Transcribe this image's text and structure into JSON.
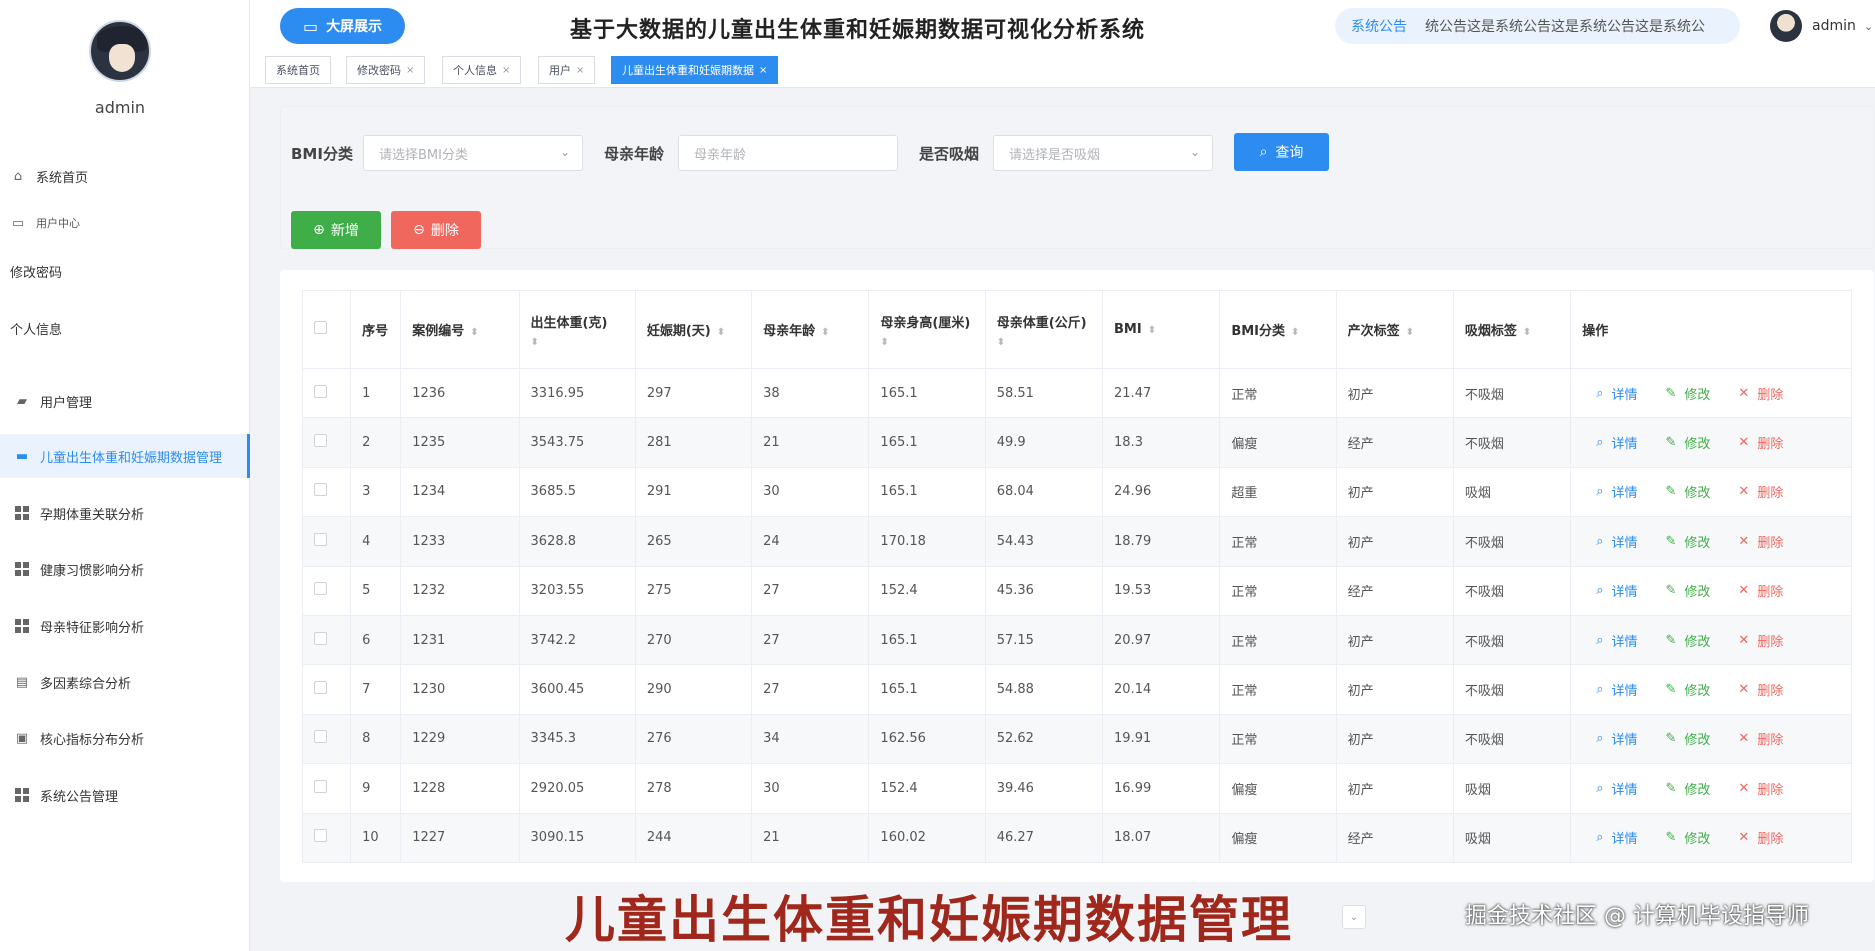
{
  "header": {
    "bigscreen_label": "大屏展示",
    "title": "基于大数据的儿童出生体重和妊娠期数据可视化分析系统",
    "notice_label": "系统公告",
    "notice_text": "统公告这是系统公告这是系统公告这是系统公",
    "username": "admin"
  },
  "sidebar": {
    "username": "admin",
    "items": [
      {
        "label": "系统首页",
        "icon": "home-icon"
      },
      {
        "label": "用户中心",
        "icon": "id-card-icon"
      },
      {
        "label": "修改密码",
        "icon": ""
      },
      {
        "label": "个人信息",
        "icon": ""
      },
      {
        "label": "用户管理",
        "icon": "user-manage-icon"
      },
      {
        "label": "儿童出生体重和妊娠期数据管理",
        "icon": "briefcase-icon"
      },
      {
        "label": "孕期体重关联分析",
        "icon": "grid-icon"
      },
      {
        "label": "健康习惯影响分析",
        "icon": "grid-icon"
      },
      {
        "label": "母亲特征影响分析",
        "icon": "grid-icon"
      },
      {
        "label": "多因素综合分析",
        "icon": "document-icon"
      },
      {
        "label": "核心指标分布分析",
        "icon": "printer-icon"
      },
      {
        "label": "系统公告管理",
        "icon": "grid-icon"
      }
    ]
  },
  "tabs": [
    {
      "label": "系统首页",
      "closable": false
    },
    {
      "label": "修改密码",
      "closable": true
    },
    {
      "label": "个人信息",
      "closable": true
    },
    {
      "label": "用户",
      "closable": true
    },
    {
      "label": "儿童出生体重和妊娠期数据",
      "closable": true,
      "active": true
    }
  ],
  "search": {
    "bmi_label": "BMI分类",
    "bmi_placeholder": "请选择BMI分类",
    "age_label": "母亲年龄",
    "age_placeholder": "母亲年龄",
    "smoke_label": "是否吸烟",
    "smoke_placeholder": "请选择是否吸烟",
    "query_label": "查询",
    "add_label": "新增",
    "delete_label": "删除"
  },
  "table": {
    "columns": [
      "序号",
      "案例编号",
      "出生体重(克)",
      "妊娠期(天)",
      "母亲年龄",
      "母亲身高(厘米)",
      "母亲体重(公斤)",
      "BMI",
      "BMI分类",
      "产次标签",
      "吸烟标签",
      "操作"
    ],
    "actions": {
      "detail": "详情",
      "edit": "修改",
      "delete": "删除"
    },
    "rows": [
      [
        "1",
        "1236",
        "3316.95",
        "297",
        "38",
        "165.1",
        "58.51",
        "21.47",
        "正常",
        "初产",
        "不吸烟"
      ],
      [
        "2",
        "1235",
        "3543.75",
        "281",
        "21",
        "165.1",
        "49.9",
        "18.3",
        "偏瘦",
        "经产",
        "不吸烟"
      ],
      [
        "3",
        "1234",
        "3685.5",
        "291",
        "30",
        "165.1",
        "68.04",
        "24.96",
        "超重",
        "初产",
        "吸烟"
      ],
      [
        "4",
        "1233",
        "3628.8",
        "265",
        "24",
        "170.18",
        "54.43",
        "18.79",
        "正常",
        "初产",
        "不吸烟"
      ],
      [
        "5",
        "1232",
        "3203.55",
        "275",
        "27",
        "152.4",
        "45.36",
        "19.53",
        "正常",
        "经产",
        "不吸烟"
      ],
      [
        "6",
        "1231",
        "3742.2",
        "270",
        "27",
        "165.1",
        "57.15",
        "20.97",
        "正常",
        "初产",
        "不吸烟"
      ],
      [
        "7",
        "1230",
        "3600.45",
        "290",
        "27",
        "165.1",
        "54.88",
        "20.14",
        "正常",
        "初产",
        "不吸烟"
      ],
      [
        "8",
        "1229",
        "3345.3",
        "276",
        "34",
        "162.56",
        "52.62",
        "19.91",
        "正常",
        "初产",
        "不吸烟"
      ],
      [
        "9",
        "1228",
        "2920.05",
        "278",
        "30",
        "152.4",
        "39.46",
        "16.99",
        "偏瘦",
        "初产",
        "吸烟"
      ],
      [
        "10",
        "1227",
        "3090.15",
        "244",
        "21",
        "160.02",
        "46.27",
        "18.07",
        "偏瘦",
        "经产",
        "吸烟"
      ]
    ]
  },
  "overlay": {
    "caption": "儿童出生体重和妊娠期数据管理",
    "watermark": "掘金技术社区 @ 计算机毕设指导师"
  },
  "colors": {
    "primary": "#2d8cf0",
    "success": "#3fae49",
    "danger": "#f0675e",
    "caption": "#a0271c"
  }
}
